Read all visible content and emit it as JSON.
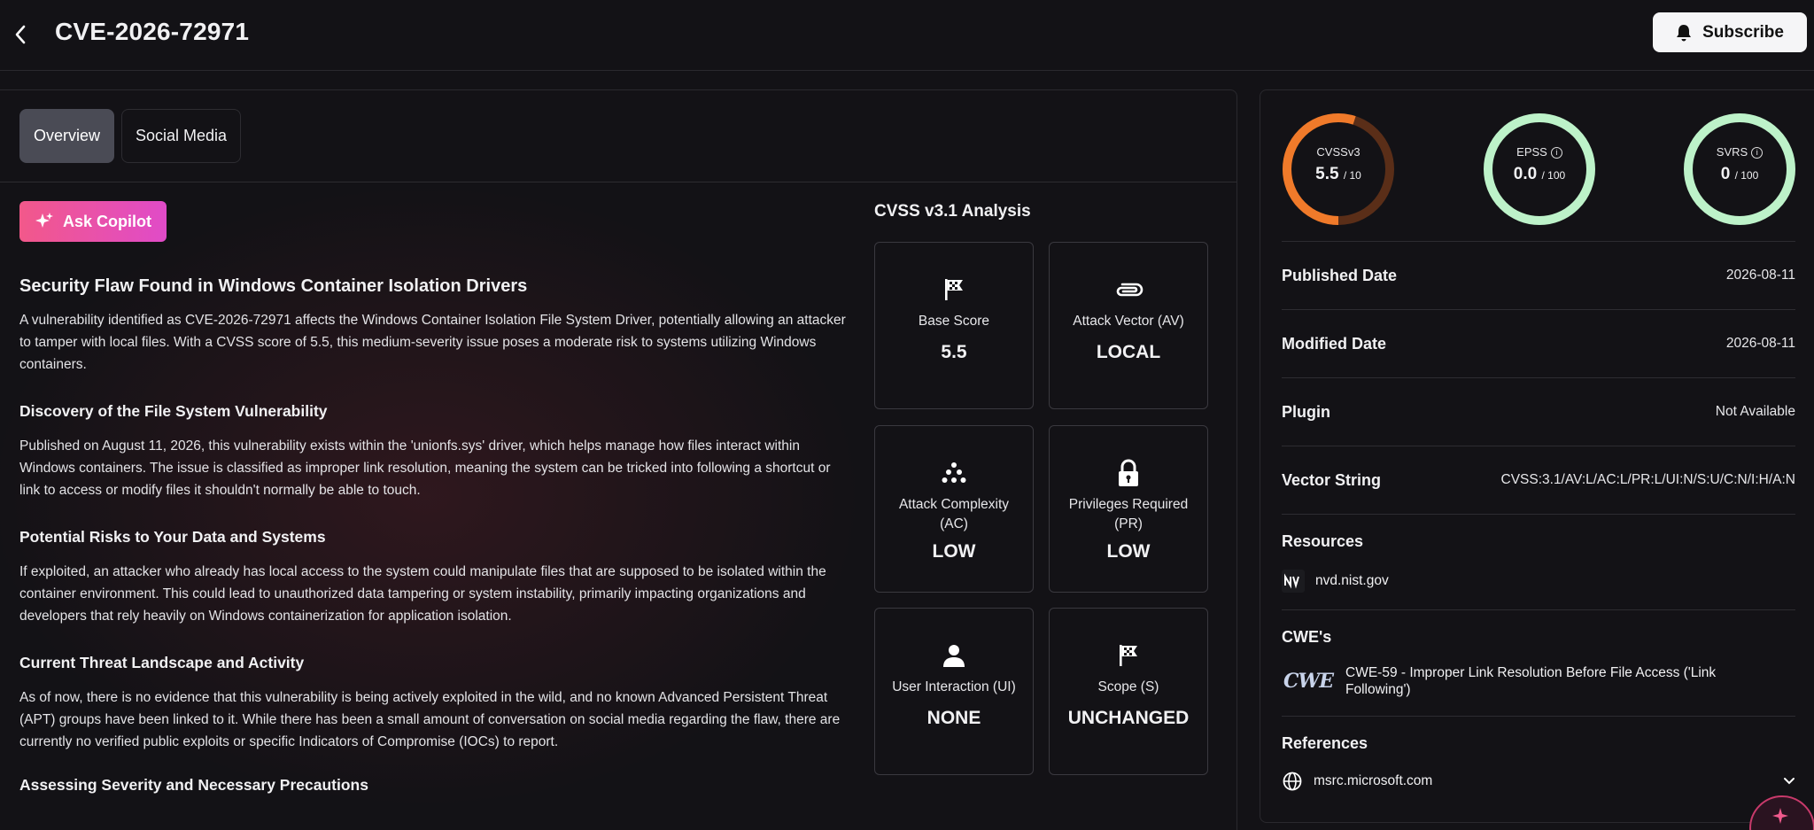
{
  "header": {
    "title": "CVE-2026-72971",
    "subscribe_label": "Subscribe"
  },
  "tabs": [
    {
      "label": "Overview",
      "active": true
    },
    {
      "label": "Social Media",
      "active": false
    }
  ],
  "copilot": {
    "label": "Ask Copilot"
  },
  "article": {
    "sections": [
      {
        "heading": "Security Flaw Found in Windows Container Isolation Drivers",
        "body": "A vulnerability identified as CVE-2026-72971 affects the Windows Container Isolation File System Driver, potentially allowing an attacker to tamper with local files. With a CVSS score of 5.5, this medium-severity issue poses a moderate risk to systems utilizing Windows containers."
      },
      {
        "heading": "Discovery of the File System Vulnerability",
        "body": "Published on August 11, 2026, this vulnerability exists within the 'unionfs.sys' driver, which helps manage how files interact within Windows containers. The issue is classified as improper link resolution, meaning the system can be tricked into following a shortcut or link to access or modify files it shouldn't normally be able to touch."
      },
      {
        "heading": "Potential Risks to Your Data and Systems",
        "body": "If exploited, an attacker who already has local access to the system could manipulate files that are supposed to be isolated within the container environment. This could lead to unauthorized data tampering or system instability, primarily impacting organizations and developers that rely heavily on Windows containerization for application isolation."
      },
      {
        "heading": "Current Threat Landscape and Activity",
        "body": "As of now, there is no evidence that this vulnerability is being actively exploited in the wild, and no known Advanced Persistent Threat (APT) groups have been linked to it. While there has been a small amount of conversation on social media regarding the flaw, there are currently no verified public exploits or specific Indicators of Compromise (IOCs) to report."
      },
      {
        "heading": "Assessing Severity and Necessary Precautions",
        "body": ""
      }
    ]
  },
  "cvss": {
    "title": "CVSS v3.1 Analysis",
    "metrics": [
      {
        "label": "Base Score",
        "value": "5.5",
        "icon": "flag-icon"
      },
      {
        "label": "Attack Vector (AV)",
        "value": "LOCAL",
        "icon": "paperclip-icon"
      },
      {
        "label": "Attack Complexity (AC)",
        "value": "LOW",
        "icon": "dots-icon"
      },
      {
        "label": "Privileges Required (PR)",
        "value": "LOW",
        "icon": "lock-icon"
      },
      {
        "label": "User Interaction (UI)",
        "value": "NONE",
        "icon": "user-icon"
      },
      {
        "label": "Scope (S)",
        "value": "UNCHANGED",
        "icon": "flag-icon"
      }
    ]
  },
  "scores": [
    {
      "name": "CVSSv3",
      "value": "5.5",
      "max": "/ 10",
      "fraction": 0.55,
      "color": "#f07a2a",
      "track": "#5a2e18"
    },
    {
      "name": "EPSS",
      "value": "0.0",
      "max": "/ 100",
      "fraction": 0.0,
      "color": "#bdf2c9",
      "track": "#bdf2c9"
    },
    {
      "name": "SVRS",
      "value": "0",
      "max": "/ 100",
      "fraction": 0.0,
      "color": "#bdf2c9",
      "track": "#bdf2c9"
    }
  ],
  "details": [
    {
      "label": "Published Date",
      "value": "2026-08-11"
    },
    {
      "label": "Modified Date",
      "value": "2026-08-11"
    },
    {
      "label": "Plugin",
      "value": "Not Available"
    },
    {
      "label": "Vector String",
      "value": "CVSS:3.1/AV:L/AC:L/PR:L/UI:N/S:U/C:N/I:H/A:N"
    }
  ],
  "resources": {
    "title": "Resources",
    "items": [
      {
        "label": "nvd.nist.gov"
      }
    ]
  },
  "cwes": {
    "title": "CWE's",
    "logo_text": "CWE",
    "items": [
      {
        "label": "CWE-59 - Improper Link Resolution Before File Access ('Link Following')"
      }
    ]
  },
  "references": {
    "title": "References",
    "items": [
      {
        "label": "msrc.microsoft.com"
      }
    ]
  }
}
